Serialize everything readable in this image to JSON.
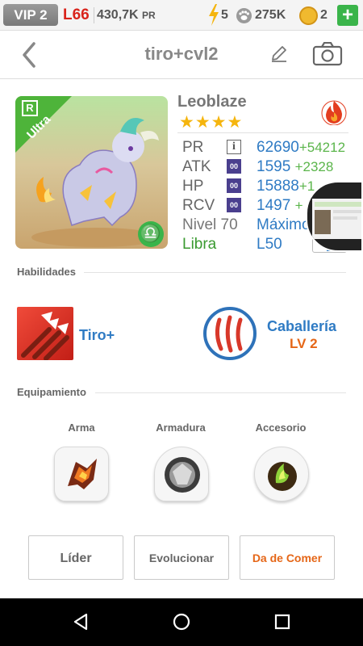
{
  "status": {
    "vip": "VIP 2",
    "level": "L66",
    "power_value": "430,7K",
    "power_unit": "PR",
    "energy": "5",
    "food": "275K",
    "coins": "2",
    "plus": "+"
  },
  "header": {
    "title": "tiro+cvl2"
  },
  "monster": {
    "name": "Leoblaze",
    "stars": "★★★★",
    "rarity_badge": "R",
    "rarity_ribbon": "Ultra",
    "element": "fire-icon",
    "zodiac_symbol": "♎",
    "stats": [
      {
        "label": "PR",
        "icon": "i",
        "value": "62690",
        "bonus": "+54212"
      },
      {
        "label": "ATK",
        "icon": "00",
        "value": "1595",
        "bonus": "+2328"
      },
      {
        "label": "HP",
        "icon": "00",
        "value": "15888",
        "bonus": "+1"
      },
      {
        "label": "RCV",
        "icon": "00",
        "value": "1497",
        "bonus": "+"
      }
    ],
    "level_label": "Nivel 70",
    "level_status": "Máximo",
    "zodiac_label": "Libra",
    "team_level": "L50"
  },
  "skills": {
    "header": "Habilidades",
    "skill_name": "Tiro+",
    "leader_name": "Caballería",
    "leader_level": "LV 2"
  },
  "equipment": {
    "header": "Equipamiento",
    "slots": [
      "Arma",
      "Armadura",
      "Accesorio"
    ]
  },
  "actions": {
    "leader": "Líder",
    "evolve": "Evolucionar",
    "feed": "Da de Comer"
  },
  "colors": {
    "accent_blue": "#2f7bc4",
    "bonus_green": "#5bb54b",
    "level_red": "#d9231b",
    "feed_orange": "#e56617",
    "ribbon_green": "#4eb43a"
  }
}
